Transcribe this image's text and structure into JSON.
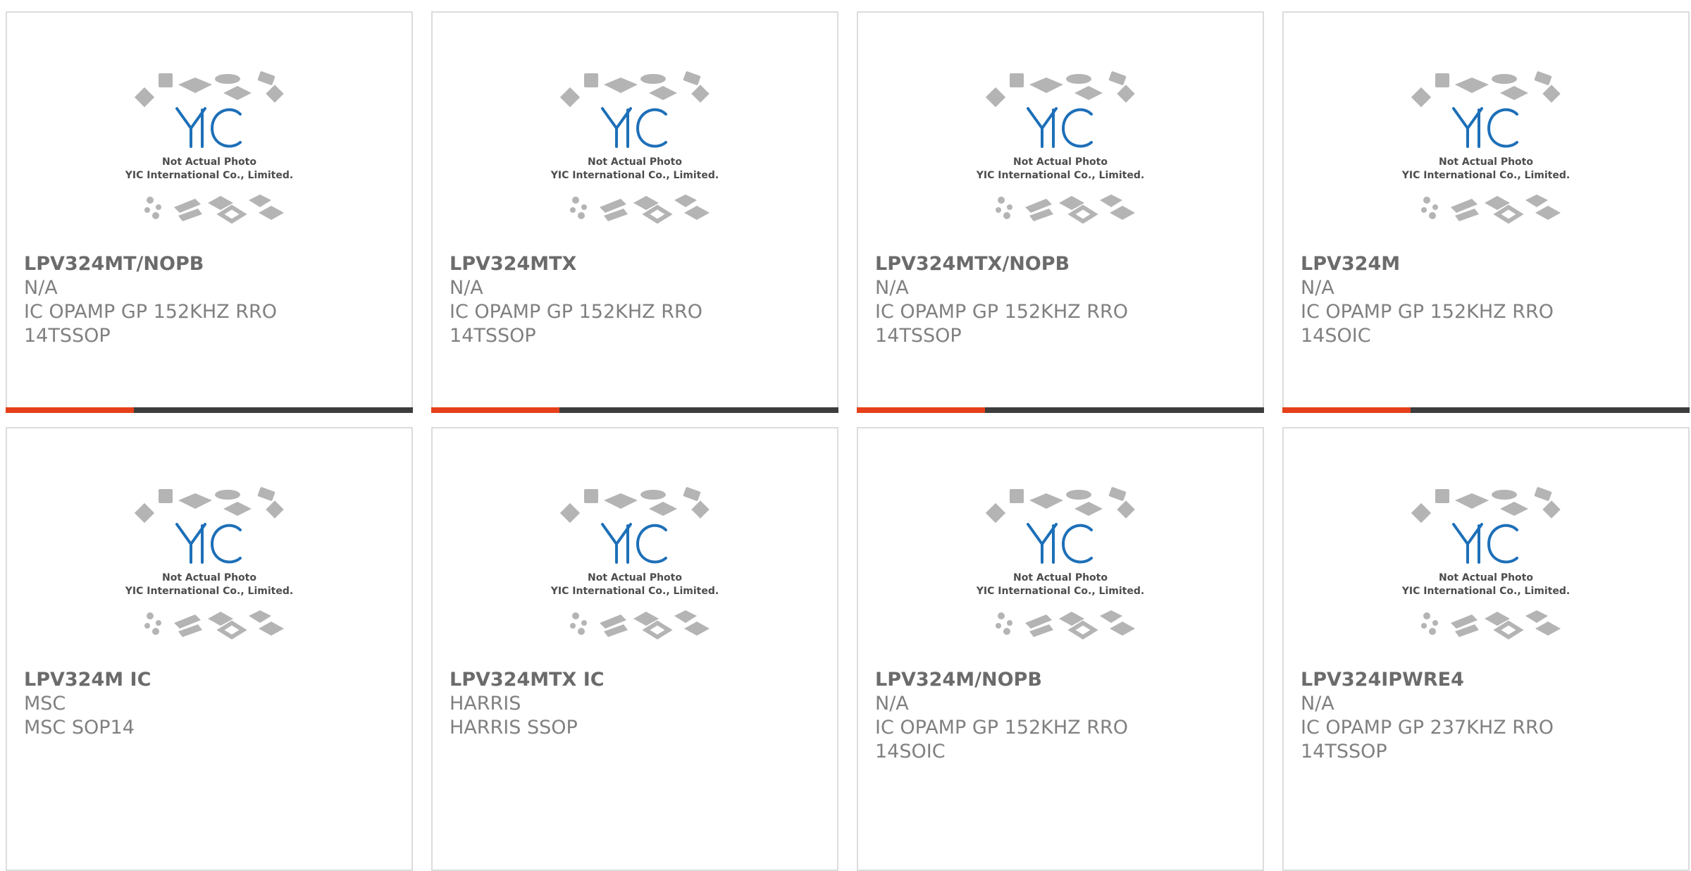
{
  "colors": {
    "accent": "#e5401a",
    "bar": "#3d3d3d",
    "logo": "#1d6fb8",
    "text": "#808080"
  },
  "placeholder": {
    "caption1": "Not Actual Photo",
    "caption2": "YIC International Co., Limited.",
    "logo": "YIC"
  },
  "products": [
    {
      "part": "LPV324MT/NOPB",
      "maker": "N/A",
      "desc1": "IC OPAMP GP 152KHZ RRO",
      "desc2": "14TSSOP"
    },
    {
      "part": "LPV324MTX",
      "maker": "N/A",
      "desc1": "IC OPAMP GP 152KHZ RRO",
      "desc2": "14TSSOP"
    },
    {
      "part": "LPV324MTX/NOPB",
      "maker": "N/A",
      "desc1": "IC OPAMP GP 152KHZ RRO",
      "desc2": "14TSSOP"
    },
    {
      "part": "LPV324M",
      "maker": "N/A",
      "desc1": "IC OPAMP GP 152KHZ RRO",
      "desc2": "14SOIC"
    },
    {
      "part": "LPV324M IC",
      "maker": "MSC",
      "desc1": "MSC SOP14",
      "desc2": ""
    },
    {
      "part": "LPV324MTX IC",
      "maker": "HARRIS",
      "desc1": "HARRIS SSOP",
      "desc2": ""
    },
    {
      "part": "LPV324M/NOPB",
      "maker": "N/A",
      "desc1": "IC OPAMP GP 152KHZ RRO",
      "desc2": "14SOIC"
    },
    {
      "part": "LPV324IPWRE4",
      "maker": "N/A",
      "desc1": "IC OPAMP GP 237KHZ RRO",
      "desc2": "14TSSOP"
    }
  ]
}
